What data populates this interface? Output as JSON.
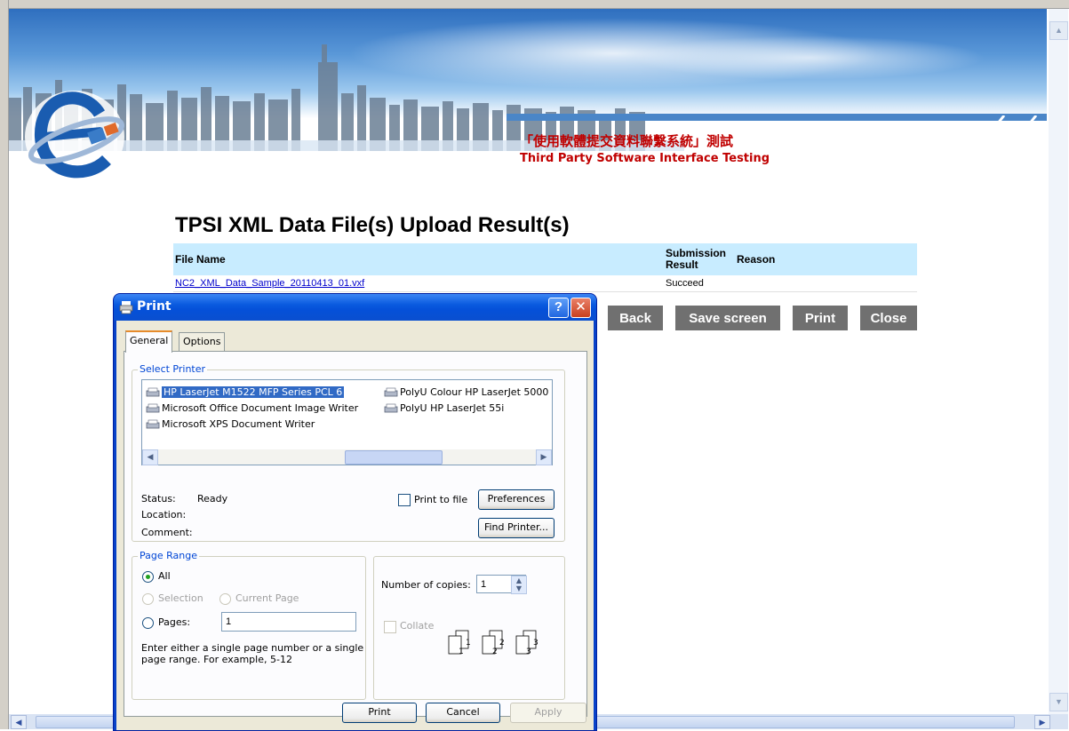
{
  "banner": {
    "title_chinese": "「使用軟體提交資料聯繫系統」測試",
    "title_english": "Third Party Software Interface Testing"
  },
  "page": {
    "heading": "TPSI XML Data File(s) Upload Result(s)"
  },
  "results_table": {
    "columns": [
      "File Name",
      "Submission Result",
      "Reason"
    ],
    "submission_line1": "Submission",
    "submission_line2": "Result",
    "rows": [
      {
        "file_name": "NC2_XML_Data_Sample_20110413_01.vxf",
        "result": "Succeed",
        "reason": ""
      }
    ]
  },
  "actions": {
    "back": "Back",
    "save_screen": "Save screen",
    "print": "Print",
    "close": "Close"
  },
  "print_dialog": {
    "title": "Print",
    "help_label": "?",
    "close_label": "✕",
    "tabs": [
      "General",
      "Options"
    ],
    "select_printer": {
      "label": "Select Printer",
      "printers": [
        {
          "name": "HP LaserJet M1522 MFP Series PCL 6",
          "selected": true
        },
        {
          "name": "Microsoft Office Document Image Writer",
          "selected": false
        },
        {
          "name": "Microsoft XPS Document Writer",
          "selected": false
        },
        {
          "name": "PolyU Colour HP LaserJet 5000",
          "selected": false
        },
        {
          "name": "PolyU HP LaserJet 55i",
          "selected": false
        }
      ],
      "scroll_left": "◀",
      "scroll_right": "▶",
      "status_label": "Status:",
      "status_value": "Ready",
      "location_label": "Location:",
      "comment_label": "Comment:",
      "print_to_file": "Print to file",
      "preferences": "Preferences",
      "find_printer": "Find Printer..."
    },
    "page_range": {
      "label": "Page Range",
      "all": "All",
      "selection": "Selection",
      "current_page": "Current Page",
      "pages": "Pages:",
      "pages_value": "1",
      "hint_line1": "Enter either a single page number or a single",
      "hint_line2": "page range.  For example, 5-12"
    },
    "copies": {
      "label": "Number of copies:",
      "value": "1",
      "collate": "Collate",
      "collate_pages": [
        "1",
        "1",
        "2",
        "2",
        "3",
        "3"
      ]
    },
    "buttons": {
      "print": "Print",
      "cancel": "Cancel",
      "apply": "Apply"
    }
  },
  "colors": {
    "banner_text": "#c00000",
    "table_header": "#c8ecff",
    "action_button": "#707070",
    "xp_titlebar": "#0a5adf"
  }
}
